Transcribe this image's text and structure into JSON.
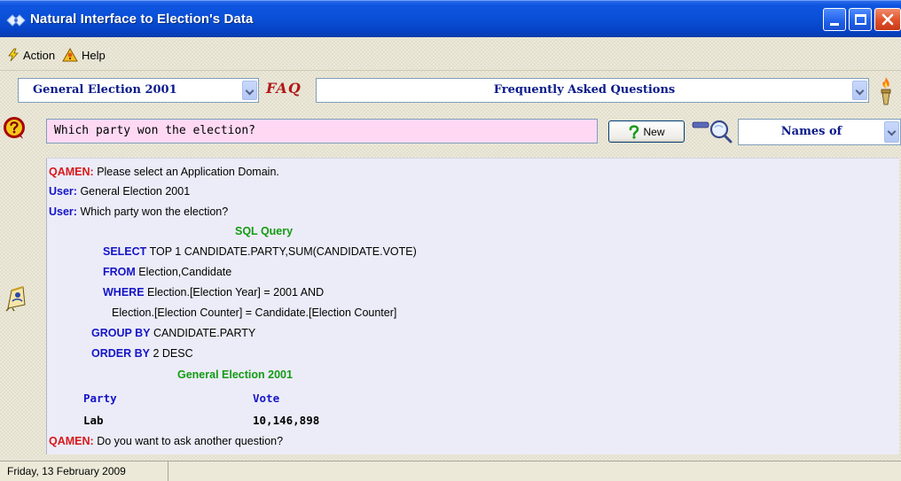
{
  "window": {
    "title": "Natural Interface to Election's Data"
  },
  "menu": {
    "action": "Action",
    "help": "Help"
  },
  "toolbar": {
    "domain_select": "General Election 2001",
    "faq_label": "FAQ",
    "faq_select": "Frequently Asked Questions"
  },
  "query": {
    "question": "Which party won the election?",
    "new_button": "New",
    "names_select": "Names of"
  },
  "conversation": {
    "qamen_speaker": "QAMEN:",
    "user_speaker": "User:",
    "msg1": "Please select an Application Domain.",
    "msg2": "General Election 2001",
    "msg3": "Which party won the election?",
    "sql_heading": "SQL Query",
    "sql": {
      "select_kw": "SELECT",
      "select_body": "TOP 1 CANDIDATE.PARTY,SUM(CANDIDATE.VOTE)",
      "from_kw": "FROM",
      "from_body": "Election,Candidate",
      "where_kw": "WHERE",
      "where_body": "Election.[Election Year] = 2001 AND",
      "where_cont": "Election.[Election Counter] = Candidate.[Election Counter]",
      "group_kw": "GROUP BY",
      "group_body": "CANDIDATE.PARTY",
      "order_kw": "ORDER BY",
      "order_body": "2 DESC"
    },
    "result_heading": "General Election 2001",
    "result_columns": [
      "Party",
      "Vote"
    ],
    "result_rows": [
      [
        "Lab",
        "10,146,898"
      ]
    ],
    "final_msg": "Do you want to ask another question?"
  },
  "status": {
    "date": "Friday, 13 February 2009"
  }
}
